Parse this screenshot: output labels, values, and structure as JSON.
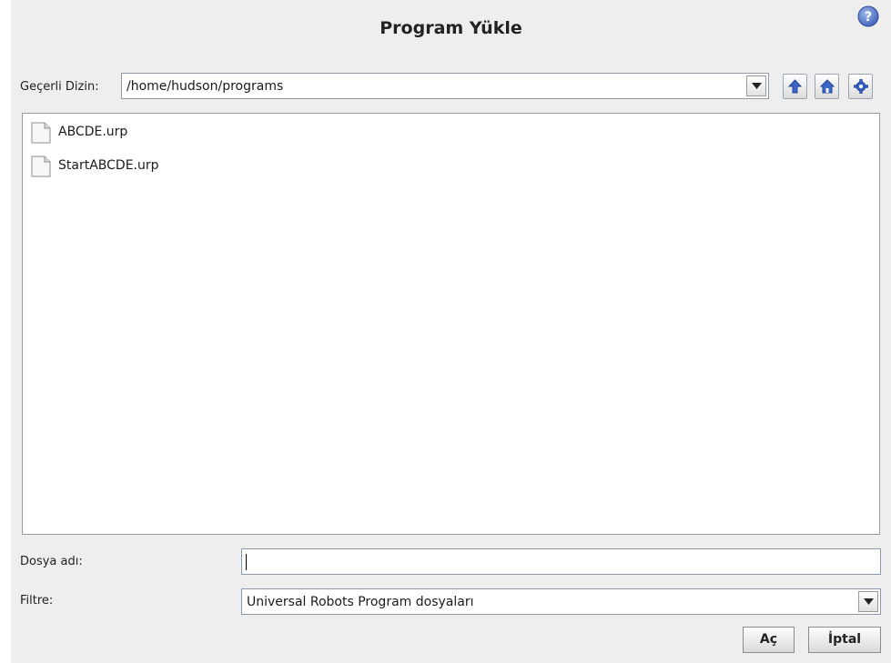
{
  "dialog": {
    "title": "Program Yükle",
    "help_icon": "help-icon"
  },
  "directory": {
    "label": "Geçerli Dizin:",
    "value": "/home/hudson/programs",
    "buttons": [
      {
        "name": "up-button",
        "icon": "arrow-up-icon"
      },
      {
        "name": "home-button",
        "icon": "home-icon"
      },
      {
        "name": "settings-button",
        "icon": "gear-icon"
      }
    ]
  },
  "files": [
    {
      "name": "ABCDE.urp",
      "icon": "file-icon"
    },
    {
      "name": "StartABCDE.urp",
      "icon": "file-icon"
    }
  ],
  "filename": {
    "label": "Dosya adı:",
    "value": ""
  },
  "filter": {
    "label": "Filtre:",
    "value": "Universal Robots Program dosyaları"
  },
  "actions": {
    "open_label": "Aç",
    "cancel_label": "İptal"
  },
  "colors": {
    "dialog_bg": "#eeeeee",
    "icon_blue": "#3a66c6",
    "border": "#8e9aa8"
  }
}
